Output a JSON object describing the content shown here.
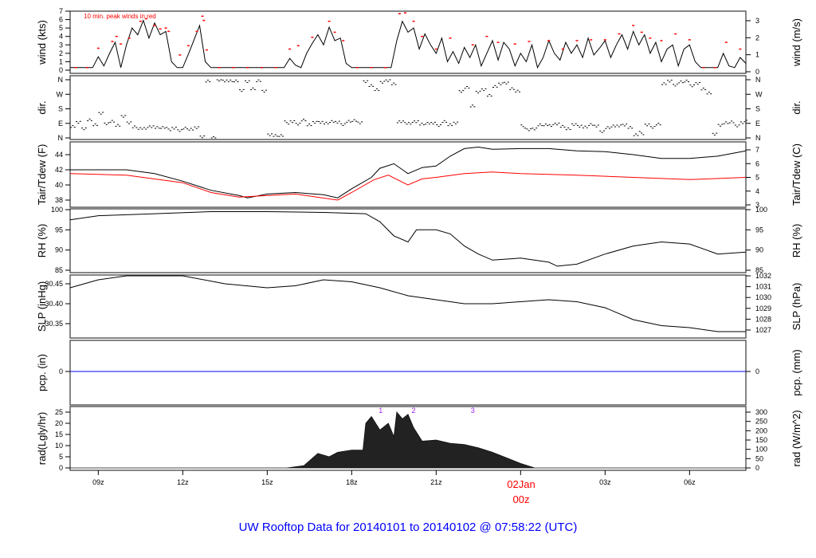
{
  "title": "UW Rooftop Data for 20140101  to  20140102 @ 07:58:22  (UTC)",
  "colors": {
    "title": "#0000ff",
    "peak": "#ff0000",
    "dew": "#ff0000",
    "pcp": "#0000ff",
    "marker": "#a020f0",
    "date": "#ff0000"
  },
  "chart_data": [
    {
      "type": "line",
      "name": "wind",
      "ylabel_left": "wind (kts)",
      "ylabel_right": "wind (m/s)",
      "annotation": "10 min. peak winds in red",
      "yticks_left": [
        "0",
        "1",
        "2",
        "3",
        "4",
        "5",
        "6",
        "7"
      ],
      "yticks_right": [
        "0",
        "1",
        "2",
        "3"
      ],
      "ylim": [
        0,
        7
      ],
      "x_start_hour": 8,
      "x_step_hour": 0.2,
      "values": [
        0.3,
        0.3,
        0.3,
        0.3,
        0.3,
        1.6,
        0.5,
        2.0,
        3.3,
        0.3,
        3.0,
        5.0,
        4.2,
        5.9,
        3.8,
        5.6,
        4.2,
        4.6,
        1.0,
        0.3,
        0.3,
        1.9,
        3.6,
        5.3,
        1.0,
        0.3,
        0.3,
        0.3,
        0.3,
        0.3,
        0.3,
        0.3,
        0.3,
        0.3,
        0.3,
        0.3,
        0.3,
        0.3,
        0.3,
        1.4,
        0.6,
        0.3,
        2.0,
        3.2,
        4.2,
        3.0,
        5.1,
        3.5,
        3.8,
        0.8,
        0.3,
        0.3,
        0.3,
        0.3,
        0.3,
        0.3,
        0.3,
        0.3,
        3.5,
        5.8,
        4.5,
        5.0,
        2.5,
        4.3,
        3.0,
        2.0,
        3.8,
        1.0,
        2.2,
        0.8,
        2.7,
        1.5,
        3.0,
        0.5,
        2.0,
        3.5,
        1.2,
        3.3,
        2.5,
        0.5,
        2.0,
        1.0,
        3.0,
        0.3,
        1.5,
        3.5,
        2.0,
        1.2,
        3.3,
        2.0,
        3.0,
        1.5,
        3.8,
        1.8,
        2.6,
        3.5,
        1.5,
        3.0,
        4.2,
        2.5,
        4.6,
        3.0,
        4.2,
        2.0,
        3.3,
        1.0,
        2.5,
        3.0,
        0.5,
        2.5,
        3.0,
        1.0,
        0.3,
        0.3,
        0.3,
        0.3,
        2.0,
        0.5,
        0.3,
        1.5,
        0.8
      ],
      "peaks": [
        [
          8.2,
          0.3
        ],
        [
          8.6,
          0.3
        ],
        [
          9.0,
          2.6
        ],
        [
          9.5,
          3.4
        ],
        [
          9.65,
          4.0
        ],
        [
          9.8,
          3.1
        ],
        [
          10.1,
          3.8
        ],
        [
          10.5,
          5.8
        ],
        [
          10.7,
          6.1
        ],
        [
          11.0,
          5.3
        ],
        [
          11.2,
          4.9
        ],
        [
          11.4,
          5.0
        ],
        [
          11.5,
          4.6
        ],
        [
          11.9,
          1.8
        ],
        [
          12.2,
          2.9
        ],
        [
          12.5,
          4.6
        ],
        [
          12.7,
          6.4
        ],
        [
          12.75,
          5.9
        ],
        [
          12.85,
          2.4
        ],
        [
          13.3,
          0.3
        ],
        [
          13.8,
          0.3
        ],
        [
          14.3,
          0.3
        ],
        [
          14.8,
          0.3
        ],
        [
          15.3,
          0.3
        ],
        [
          15.8,
          2.5
        ],
        [
          16.1,
          2.9
        ],
        [
          16.6,
          3.9
        ],
        [
          17.2,
          5.8
        ],
        [
          17.4,
          4.5
        ],
        [
          17.7,
          3.5
        ],
        [
          18.2,
          0.3
        ],
        [
          18.7,
          0.3
        ],
        [
          19.2,
          0.3
        ],
        [
          19.7,
          6.7
        ],
        [
          19.9,
          6.8
        ],
        [
          20.2,
          5.8
        ],
        [
          20.5,
          4.0
        ],
        [
          21.0,
          2.5
        ],
        [
          21.5,
          3.8
        ],
        [
          22.3,
          3.0
        ],
        [
          22.8,
          4.0
        ],
        [
          23.2,
          3.3
        ],
        [
          23.8,
          3.1
        ],
        [
          24.3,
          3.4
        ],
        [
          25.0,
          3.5
        ],
        [
          25.5,
          2.5
        ],
        [
          26.0,
          3.5
        ],
        [
          26.5,
          3.6
        ],
        [
          27.0,
          3.6
        ],
        [
          27.5,
          4.3
        ],
        [
          28.0,
          5.3
        ],
        [
          28.3,
          4.5
        ],
        [
          28.6,
          3.8
        ],
        [
          29.0,
          3.5
        ],
        [
          29.5,
          4.3
        ],
        [
          30.0,
          3.6
        ],
        [
          30.5,
          0.3
        ],
        [
          30.9,
          0.3
        ],
        [
          31.3,
          3.3
        ],
        [
          31.8,
          2.5
        ]
      ]
    },
    {
      "type": "scatter",
      "name": "direction",
      "ylabel_left": "dir.",
      "ylabel_right": "dir.",
      "yticks": [
        "N",
        "E",
        "S",
        "W",
        "N"
      ],
      "ylim": [
        0,
        360
      ],
      "x_start_hour": 8,
      "x_step_hour": 0.2,
      "values": [
        75,
        95,
        60,
        110,
        85,
        150,
        90,
        100,
        80,
        130,
        95,
        65,
        60,
        55,
        70,
        60,
        65,
        55,
        60,
        50,
        60,
        58,
        62,
        10,
        350,
        5,
        355,
        355,
        350,
        355,
        290,
        350,
        300,
        355,
        285,
        20,
        10,
        15,
        95,
        100,
        90,
        110,
        85,
        95,
        100,
        90,
        105,
        95,
        85,
        100,
        110,
        90,
        350,
        320,
        300,
        340,
        355,
        330,
        100,
        95,
        90,
        105,
        85,
        95,
        90,
        80,
        100,
        85,
        90,
        290,
        310,
        200,
        280,
        300,
        260,
        320,
        330,
        340,
        300,
        290,
        70,
        50,
        60,
        80,
        85,
        75,
        90,
        70,
        60,
        80,
        75,
        65,
        85,
        70,
        40,
        60,
        75,
        70,
        80,
        60,
        20,
        30,
        80,
        70,
        85,
        340,
        350,
        330,
        345,
        355,
        320,
        340,
        300,
        280,
        20,
        80,
        90,
        100,
        70,
        95,
        110
      ]
    },
    {
      "type": "line",
      "name": "temperature",
      "ylabel_left": "Tair/Tdew (F)",
      "ylabel_right": "Tair/Tdew (C)",
      "yticks_left": [
        "38",
        "40",
        "42",
        "44"
      ],
      "yticks_right": [
        "3",
        "4",
        "5",
        "6",
        "7"
      ],
      "series": [
        {
          "name": "Tair",
          "points": [
            [
              8,
              42
            ],
            [
              9,
              42
            ],
            [
              10,
              42
            ],
            [
              11,
              41.5
            ],
            [
              12,
              40.5
            ],
            [
              13,
              39.3
            ],
            [
              14,
              38.6
            ],
            [
              14.3,
              38.3
            ],
            [
              15,
              38.8
            ],
            [
              16,
              39
            ],
            [
              17,
              38.7
            ],
            [
              17.5,
              38.3
            ],
            [
              18,
              39.5
            ],
            [
              18.7,
              41
            ],
            [
              19,
              42.2
            ],
            [
              19.5,
              42.8
            ],
            [
              20,
              41.5
            ],
            [
              20.5,
              42.3
            ],
            [
              21,
              42.5
            ],
            [
              21.5,
              43.8
            ],
            [
              22,
              44.8
            ],
            [
              22.5,
              45
            ],
            [
              23,
              44.7
            ],
            [
              24,
              44.8
            ],
            [
              25,
              44.8
            ],
            [
              26,
              44.5
            ],
            [
              27,
              44.4
            ],
            [
              28,
              44
            ],
            [
              29,
              43.5
            ],
            [
              30,
              43.5
            ],
            [
              31,
              43.8
            ],
            [
              32,
              44.5
            ]
          ]
        },
        {
          "name": "Tdew",
          "points": [
            [
              8,
              41.5
            ],
            [
              10,
              41.3
            ],
            [
              12,
              40.3
            ],
            [
              13,
              39
            ],
            [
              14,
              38.4
            ],
            [
              16,
              38.8
            ],
            [
              17.5,
              38
            ],
            [
              18,
              39
            ],
            [
              18.8,
              40.7
            ],
            [
              19.3,
              41.3
            ],
            [
              20,
              40
            ],
            [
              20.5,
              40.8
            ],
            [
              21,
              41
            ],
            [
              22,
              41.5
            ],
            [
              23,
              41.7
            ],
            [
              24,
              41.5
            ],
            [
              26,
              41.3
            ],
            [
              28,
              41
            ],
            [
              30,
              40.7
            ],
            [
              32,
              41
            ]
          ]
        }
      ]
    },
    {
      "type": "line",
      "name": "rh",
      "ylabel_left": "RH (%)",
      "ylabel_right": "RH (%)",
      "yticks": [
        "85",
        "90",
        "95",
        "100"
      ],
      "points": [
        [
          8,
          97.5
        ],
        [
          9,
          98.5
        ],
        [
          11,
          99
        ],
        [
          13,
          99.5
        ],
        [
          15,
          99.5
        ],
        [
          17,
          99.3
        ],
        [
          18.5,
          99
        ],
        [
          19,
          97
        ],
        [
          19.5,
          93.5
        ],
        [
          20,
          92
        ],
        [
          20.3,
          95
        ],
        [
          21,
          95
        ],
        [
          21.5,
          94
        ],
        [
          22,
          91
        ],
        [
          22.5,
          89
        ],
        [
          23,
          87.5
        ],
        [
          24,
          88
        ],
        [
          25,
          87
        ],
        [
          25.3,
          86
        ],
        [
          26,
          86.5
        ],
        [
          27,
          89
        ],
        [
          28,
          91
        ],
        [
          29,
          92
        ],
        [
          30,
          91.5
        ],
        [
          31,
          89
        ],
        [
          32,
          89.5
        ]
      ]
    },
    {
      "type": "line",
      "name": "slp",
      "ylabel_left": "SLP (inHg)",
      "ylabel_right": "SLP (hPa)",
      "yticks_left": [
        "30.35",
        "30.40",
        "30.45"
      ],
      "yticks_right": [
        "1027",
        "1028",
        "1029",
        "1030",
        "1031",
        "1032"
      ],
      "points": [
        [
          8,
          30.44
        ],
        [
          9,
          30.46
        ],
        [
          10,
          30.47
        ],
        [
          12,
          30.47
        ],
        [
          13.5,
          30.45
        ],
        [
          15,
          30.44
        ],
        [
          16,
          30.445
        ],
        [
          17,
          30.46
        ],
        [
          18,
          30.455
        ],
        [
          19,
          30.44
        ],
        [
          20,
          30.42
        ],
        [
          22,
          30.4
        ],
        [
          23,
          30.4
        ],
        [
          25,
          30.41
        ],
        [
          26,
          30.405
        ],
        [
          27,
          30.39
        ],
        [
          28,
          30.36
        ],
        [
          29,
          30.345
        ],
        [
          30,
          30.34
        ],
        [
          31,
          30.33
        ],
        [
          32,
          30.33
        ]
      ]
    },
    {
      "type": "line",
      "name": "precip",
      "ylabel_left": "pcp. (in)",
      "ylabel_right": "pcp. (mm)",
      "yticks_left": [
        "0"
      ],
      "yticks_right": [
        "0"
      ],
      "points": [
        [
          8,
          0
        ],
        [
          32,
          0
        ]
      ]
    },
    {
      "type": "area",
      "name": "radiation",
      "ylabel_left": "rad(Lgly/hr)",
      "ylabel_right": "rad (W/m^2)",
      "yticks_left": [
        "0",
        "5",
        "10",
        "15",
        "20",
        "25"
      ],
      "yticks_right": [
        "0",
        "50",
        "100",
        "150",
        "200",
        "250",
        "300"
      ],
      "points": [
        [
          8,
          0
        ],
        [
          15.7,
          0
        ],
        [
          16.3,
          1
        ],
        [
          16.8,
          6.5
        ],
        [
          17.2,
          5
        ],
        [
          17.5,
          7
        ],
        [
          18,
          8
        ],
        [
          18.4,
          8
        ],
        [
          18.5,
          20
        ],
        [
          18.7,
          23
        ],
        [
          19,
          17
        ],
        [
          19.3,
          20
        ],
        [
          19.5,
          14
        ],
        [
          19.6,
          25
        ],
        [
          19.8,
          22
        ],
        [
          20,
          24
        ],
        [
          20.2,
          18
        ],
        [
          20.5,
          12
        ],
        [
          21,
          12.5
        ],
        [
          21.5,
          11
        ],
        [
          22,
          10.5
        ],
        [
          22.5,
          9
        ],
        [
          23,
          7
        ],
        [
          23.5,
          4.5
        ],
        [
          24,
          2
        ],
        [
          24.5,
          0
        ],
        [
          32,
          0
        ]
      ],
      "markers": [
        {
          "label": "1",
          "hour": 19.03
        },
        {
          "label": "2",
          "hour": 20.2
        },
        {
          "label": "3",
          "hour": 22.3
        }
      ]
    }
  ],
  "xaxis": {
    "range_hours": [
      8,
      32
    ],
    "ticks": [
      {
        "hour": 9,
        "label": "09z"
      },
      {
        "hour": 12,
        "label": "12z"
      },
      {
        "hour": 15,
        "label": "15z"
      },
      {
        "hour": 18,
        "label": "18z"
      },
      {
        "hour": 21,
        "label": "21z"
      },
      {
        "hour": 27,
        "label": "03z"
      },
      {
        "hour": 30,
        "label": "06z"
      }
    ],
    "date_tick": {
      "hour": 24,
      "date": "02Jan",
      "label": "00z"
    }
  }
}
